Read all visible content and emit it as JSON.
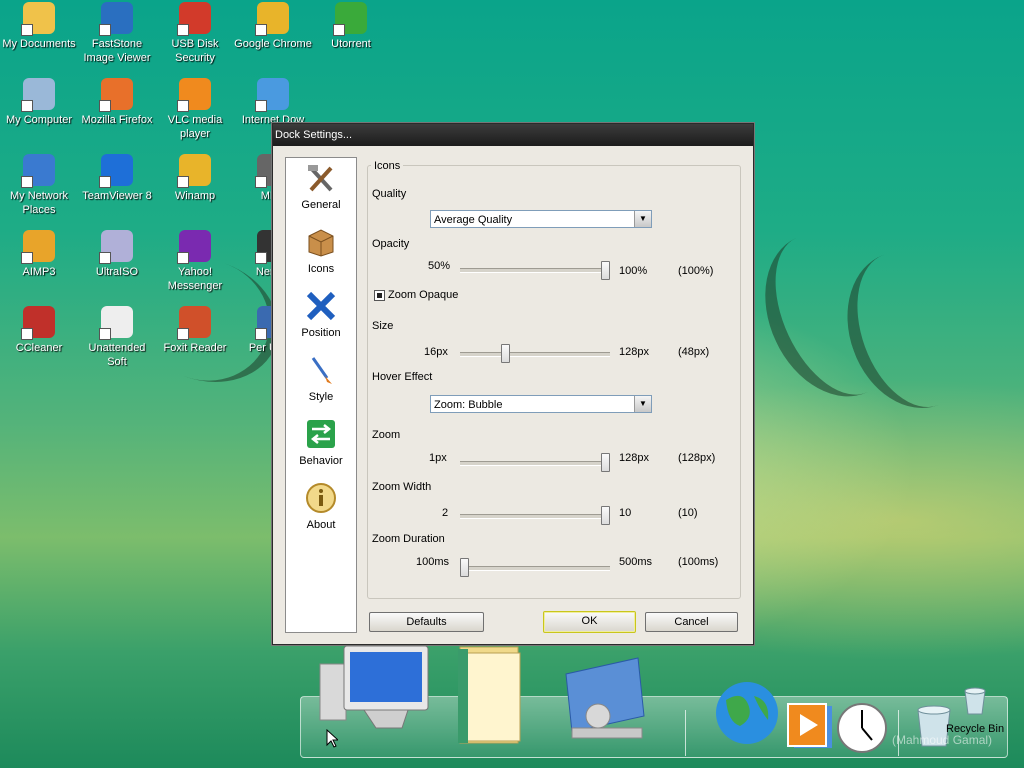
{
  "desktop": {
    "icons": [
      {
        "label": "My Documents",
        "icon": "folder-documents-icon"
      },
      {
        "label": "FastStone Image Viewer",
        "icon": "faststone-icon"
      },
      {
        "label": "USB Disk Security",
        "icon": "usb-shield-icon"
      },
      {
        "label": "Google Chrome",
        "icon": "chrome-icon"
      },
      {
        "label": "Utorrent",
        "icon": "utorrent-icon"
      },
      {
        "label": "My Computer",
        "icon": "computer-icon"
      },
      {
        "label": "Mozilla Firefox",
        "icon": "firefox-icon"
      },
      {
        "label": "VLC media player",
        "icon": "vlc-icon"
      },
      {
        "label": "Internet Dow",
        "icon": "download-manager-icon"
      },
      {
        "label": "My Network Places",
        "icon": "network-icon"
      },
      {
        "label": "TeamViewer 8",
        "icon": "teamviewer-icon"
      },
      {
        "label": "Winamp",
        "icon": "winamp-icon"
      },
      {
        "label": "MPC",
        "icon": "mpc-icon"
      },
      {
        "label": "AIMP3",
        "icon": "aimp-icon"
      },
      {
        "label": "UltraISO",
        "icon": "disc-icon"
      },
      {
        "label": "Yahoo! Messenger",
        "icon": "yahoo-icon"
      },
      {
        "label": "Nero E",
        "icon": "nero-icon"
      },
      {
        "label": "CCleaner",
        "icon": "ccleaner-icon"
      },
      {
        "label": "Unattended Soft",
        "icon": "document-icon"
      },
      {
        "label": "Foxit Reader",
        "icon": "foxit-icon"
      },
      {
        "label": "Per Unins",
        "icon": "uninstaller-icon"
      }
    ]
  },
  "dialog": {
    "title": "Dock Settings...",
    "nav": [
      {
        "label": "General",
        "icon": "tools-icon"
      },
      {
        "label": "Icons",
        "icon": "box-icon"
      },
      {
        "label": "Position",
        "icon": "arrows-icon"
      },
      {
        "label": "Style",
        "icon": "paintbrush-icon"
      },
      {
        "label": "Behavior",
        "icon": "swap-arrows-icon"
      },
      {
        "label": "About",
        "icon": "info-icon"
      }
    ],
    "group_title": "Icons",
    "quality": {
      "label": "Quality",
      "value": "Average Quality"
    },
    "opacity": {
      "label": "Opacity",
      "min": "50%",
      "max": "100%",
      "current": "(100%)",
      "level": 1.0
    },
    "zoom_opaque": {
      "label": "Zoom Opaque",
      "checked": true
    },
    "size": {
      "label": "Size",
      "min": "16px",
      "max": "128px",
      "current": "(48px)",
      "level": 0.29
    },
    "hover_effect": {
      "label": "Hover Effect",
      "value": "Zoom: Bubble"
    },
    "zoom": {
      "label": "Zoom",
      "min": "1px",
      "max": "128px",
      "current": "(128px)",
      "level": 1.0
    },
    "zoom_width": {
      "label": "Zoom Width",
      "min": "2",
      "max": "10",
      "current": "(10)",
      "level": 1.0
    },
    "zoom_duration": {
      "label": "Zoom Duration",
      "min": "100ms",
      "max": "500ms",
      "current": "(100ms)",
      "level": 0.0
    },
    "buttons": {
      "defaults": "Defaults",
      "ok": "OK",
      "cancel": "Cancel"
    }
  },
  "dock": {
    "items": [
      {
        "icon": "computer-monitor-icon"
      },
      {
        "icon": "folder-icon"
      },
      {
        "icon": "control-panel-icon"
      },
      {
        "icon": "globe-icon"
      },
      {
        "icon": "media-player-icon"
      },
      {
        "icon": "clock-icon"
      },
      {
        "icon": "recycle-bin-icon"
      }
    ],
    "recycle_bin_label": "Recycle Bin",
    "watermark": "(Mahmoud Gamal)"
  },
  "colors": {
    "desktop_teal": "#0aa48a",
    "dialog_bg": "#ece9e2",
    "titlebar": "#1c1c1c"
  }
}
